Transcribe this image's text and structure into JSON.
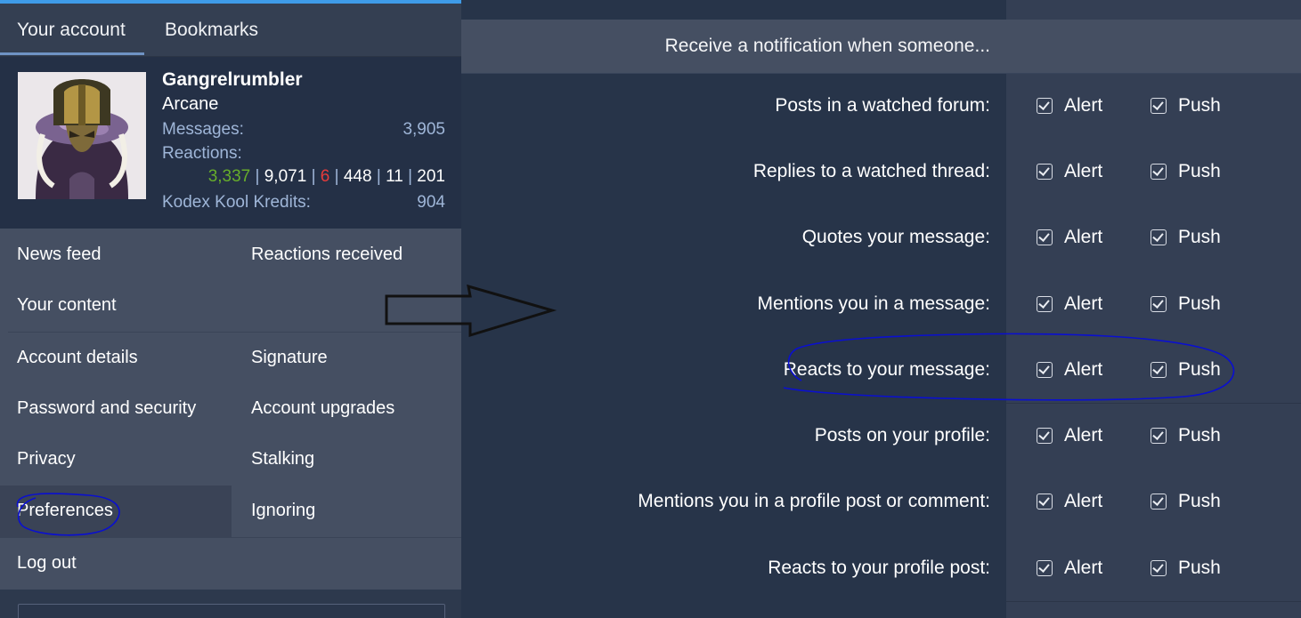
{
  "left": {
    "tabs": [
      {
        "label": "Your account",
        "active": true
      },
      {
        "label": "Bookmarks",
        "active": false
      }
    ],
    "profile": {
      "username": "Gangrelrumbler",
      "user_title": "Arcane",
      "messages_label": "Messages:",
      "messages_value": "3,905",
      "reactions_label": "Reactions:",
      "reactions": {
        "positive": "3,337",
        "neutral": "9,071",
        "negative": "6",
        "r4": "448",
        "r5": "11",
        "r6": "201",
        "separator": "|"
      },
      "kredits_label": "Kodex Kool Kredits:",
      "kredits_value": "904"
    },
    "menu": {
      "news_feed": "News feed",
      "reactions_received": "Reactions received",
      "your_content": "Your content",
      "account_details": "Account details",
      "signature": "Signature",
      "password_security": "Password and security",
      "account_upgrades": "Account upgrades",
      "privacy": "Privacy",
      "stalking": "Stalking",
      "preferences": "Preferences",
      "ignoring": "Ignoring",
      "log_out": "Log out"
    }
  },
  "right": {
    "header": "Receive a notification when someone...",
    "rows": [
      {
        "label": "Posts in a watched forum:",
        "alert": "Alert",
        "push": "Push"
      },
      {
        "label": "Replies to a watched thread:",
        "alert": "Alert",
        "push": "Push"
      },
      {
        "label": "Quotes your message:",
        "alert": "Alert",
        "push": "Push"
      },
      {
        "label": "Mentions you in a message:",
        "alert": "Alert",
        "push": "Push"
      },
      {
        "label": "Reacts to your message:",
        "alert": "Alert",
        "push": "Push"
      },
      {
        "label": "Posts on your profile:",
        "alert": "Alert",
        "push": "Push"
      },
      {
        "label": "Mentions you in a profile post or comment:",
        "alert": "Alert",
        "push": "Push"
      },
      {
        "label": "Reacts to your profile post:",
        "alert": "Alert",
        "push": "Push"
      }
    ]
  },
  "colors": {
    "accent": "#3e9be8",
    "reaction_positive": "#67ad2b",
    "reaction_negative": "#e53b3b",
    "annotation": "#0a0fd0"
  },
  "icons": {
    "checkbox": "checked-checkbox-icon",
    "arrow": "right-arrow-annotation-icon"
  }
}
